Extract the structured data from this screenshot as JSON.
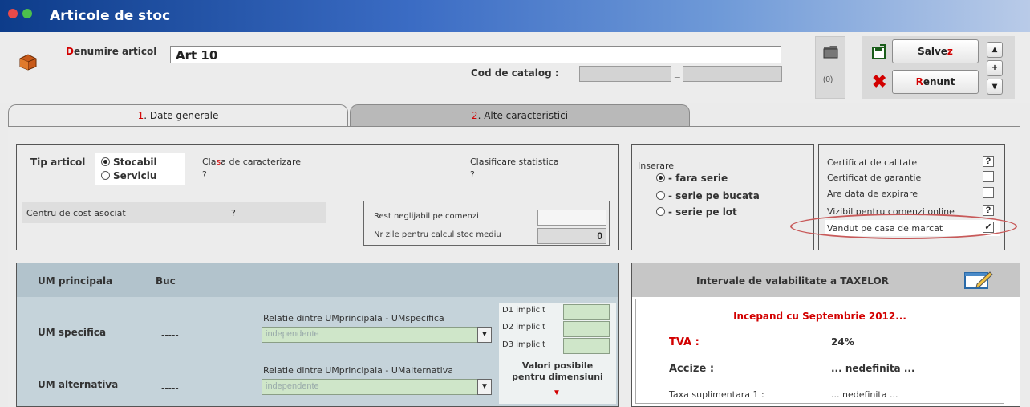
{
  "window": {
    "title": "Articole de stoc"
  },
  "header": {
    "name_label_first": "D",
    "name_label_rest": "enumire articol",
    "name_value": "Art 10",
    "catalog_label": "Cod de catalog :",
    "count_badge": "(0)",
    "save_label": "Salve",
    "save_hotkey": "z",
    "cancel_hotkey": "R",
    "cancel_label": "enunt"
  },
  "tabs": [
    {
      "num": "1",
      "label": ". Date generale"
    },
    {
      "num": "2",
      "label": ". Alte caracteristici"
    }
  ],
  "general": {
    "tip_label": "Tip articol",
    "tip_options": [
      "Stocabil",
      "Serviciu"
    ],
    "clasa_label_a": "Cla",
    "clasa_label_hot": "s",
    "clasa_label_b": "a de caracterizare",
    "clasa_value": "?",
    "clasificare_label": "Clasificare statistica",
    "clasificare_value": "?",
    "centru_label": "Centru de cost asociat",
    "centru_value": "?",
    "rest_label": "Rest neglijabil pe comenzi",
    "nr_zile_label": "Nr zile pentru calcul stoc mediu",
    "nr_zile_value": "0"
  },
  "inserare": {
    "label": "Inserare",
    "options": [
      "- fara serie",
      "- serie pe bucata",
      "- serie pe lot"
    ]
  },
  "flags": [
    {
      "label": "Certificat de calitate",
      "mark": "?"
    },
    {
      "label": "Certificat de garantie",
      "mark": ""
    },
    {
      "label": "Are data de expirare",
      "mark": ""
    },
    {
      "label": "Vizibil pentru comenzi online",
      "mark": "?"
    },
    {
      "label": "Vandut pe casa de marcat",
      "mark": "✓"
    }
  ],
  "um": {
    "principala_label": "UM principala",
    "principala_value": "Buc",
    "specifica_label": "UM specifica",
    "specifica_value": "-----",
    "relatie1_label": "Relatie dintre UMprincipala - UMspecifica",
    "relatie1_value": "independente",
    "alternativa_label": "UM alternativa",
    "alternativa_value": "-----",
    "relatie2_label": "Relatie dintre UMprincipala - UMalternativa",
    "relatie2_value": "independente",
    "d1": "D1 implicit",
    "d2": "D2 implicit",
    "d3": "D3 implicit",
    "valori_line1": "Valori posibile",
    "valori_line2": "pentru dimensiuni"
  },
  "taxe": {
    "title": "Intervale de valabilitate a TAXELOR",
    "subtitle": "Incepand cu Septembrie 2012...",
    "tva_label": "TVA :",
    "tva_value": "24%",
    "accize_label": "Accize :",
    "accize_value": "... nedefinita ...",
    "taxa_label": "Taxa suplimentara 1 :",
    "taxa_value": "... nedefinita ..."
  }
}
